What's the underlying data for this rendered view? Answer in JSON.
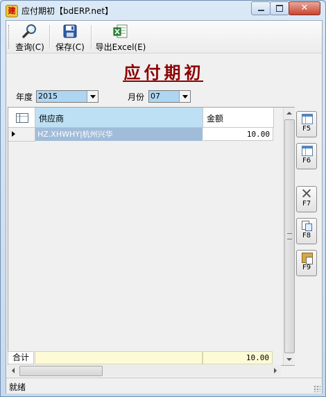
{
  "window": {
    "title": "应付期初【bdERP.net】",
    "icon": "app-logo-icon",
    "close_glyph": "✕"
  },
  "toolbar": {
    "buttons": [
      {
        "label": "查询(C)",
        "icon": "magnifier-icon"
      },
      {
        "label": "保存(C)",
        "icon": "floppy-disk-icon"
      },
      {
        "label": "导出Excel(E)",
        "icon": "excel-icon"
      }
    ]
  },
  "form": {
    "title": "应付期初",
    "year_label": "年度",
    "year_value": "2015",
    "month_label": "月份",
    "month_value": "07"
  },
  "grid": {
    "columns": [
      "供应商",
      "金额"
    ],
    "rows": [
      {
        "vendor": "HZ.XHWHY|杭州兴华",
        "amount": "10.00"
      }
    ],
    "total_label": "合计",
    "total_amount": "10.00"
  },
  "side_buttons": [
    {
      "key": "F5",
      "icon": "grid-add-icon"
    },
    {
      "key": "F6",
      "icon": "grid-insert-icon"
    },
    {
      "key": "F7",
      "icon": "delete-x-icon"
    },
    {
      "key": "F8",
      "icon": "copy-icon"
    },
    {
      "key": "F9",
      "icon": "paste-icon"
    }
  ],
  "status": {
    "text": "就绪"
  },
  "colors": {
    "title_red": "#8b0000",
    "selected_cell": "#a0bcd9",
    "header_highlight": "#bde0f5",
    "total_row": "#fdfbd6"
  }
}
